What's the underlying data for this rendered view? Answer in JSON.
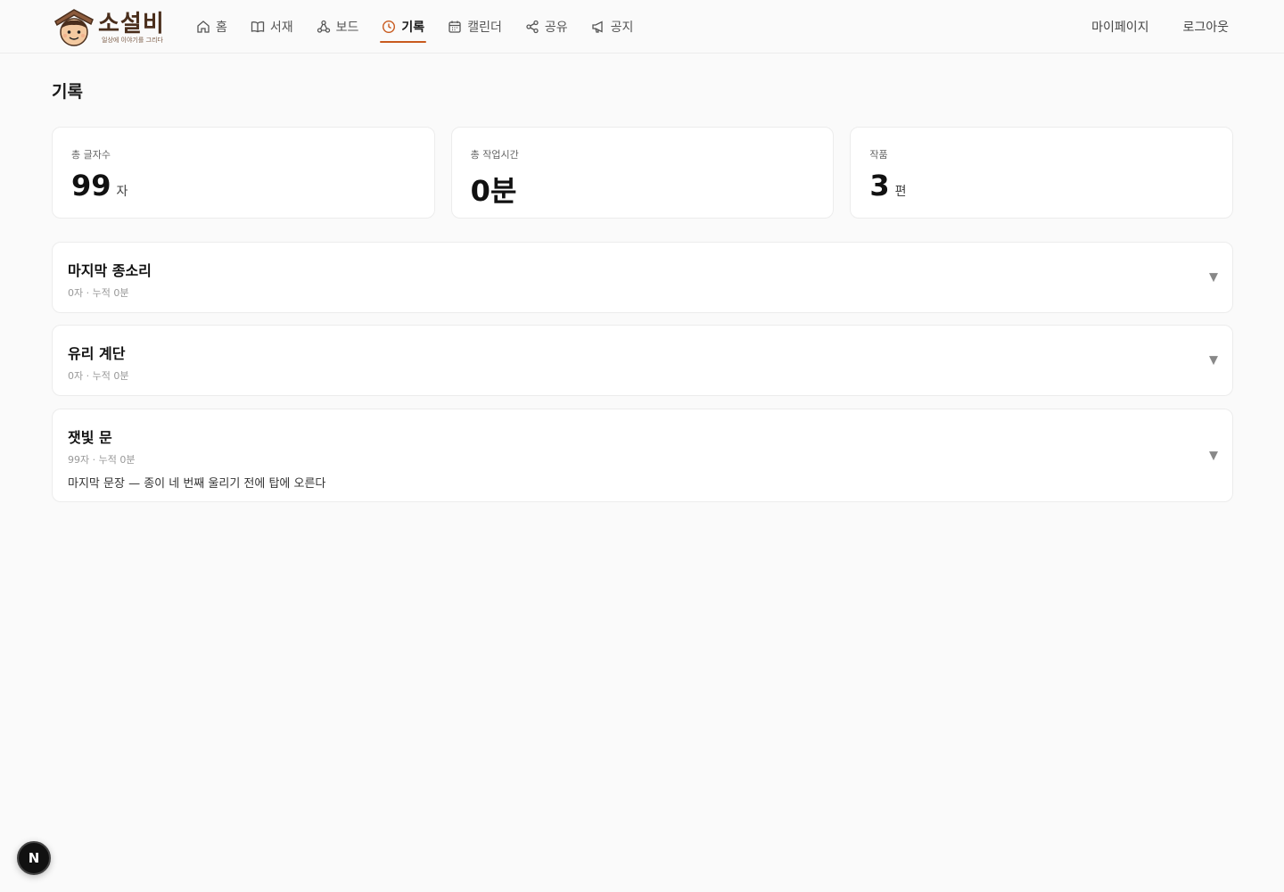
{
  "brand": {
    "name": "소설비",
    "tagline": "일상에 이야기를 그리다",
    "accent_color": "#c85a1e"
  },
  "nav": [
    {
      "label": "홈",
      "icon": "home-icon",
      "active": false
    },
    {
      "label": "서재",
      "icon": "book-icon",
      "active": false
    },
    {
      "label": "보드",
      "icon": "board-icon",
      "active": false
    },
    {
      "label": "기록",
      "icon": "clock-icon",
      "active": true
    },
    {
      "label": "캘린더",
      "icon": "calendar-icon",
      "active": false
    },
    {
      "label": "공유",
      "icon": "share-icon",
      "active": false
    },
    {
      "label": "공지",
      "icon": "megaphone-icon",
      "active": false
    }
  ],
  "header_right": {
    "mypage": "마이페이지",
    "logout": "로그아웃"
  },
  "page": {
    "title": "기록"
  },
  "stats": [
    {
      "label": "총 글자수",
      "value": "99",
      "unit": "자"
    },
    {
      "label": "총 작업시간",
      "value": "0분",
      "unit": ""
    },
    {
      "label": "작품",
      "value": "3",
      "unit": "편"
    }
  ],
  "works": [
    {
      "title": "마지막 종소리",
      "meta": "0자 · 누적 0분",
      "excerpt": ""
    },
    {
      "title": "유리 계단",
      "meta": "0자 · 누적 0분",
      "excerpt": ""
    },
    {
      "title": "잿빛 문",
      "meta": "99자 · 누적 0분",
      "excerpt": "마지막 문장 — 종이 네 번째 울리기 전에 탑에 오른다"
    }
  ],
  "dev_badge": "N"
}
